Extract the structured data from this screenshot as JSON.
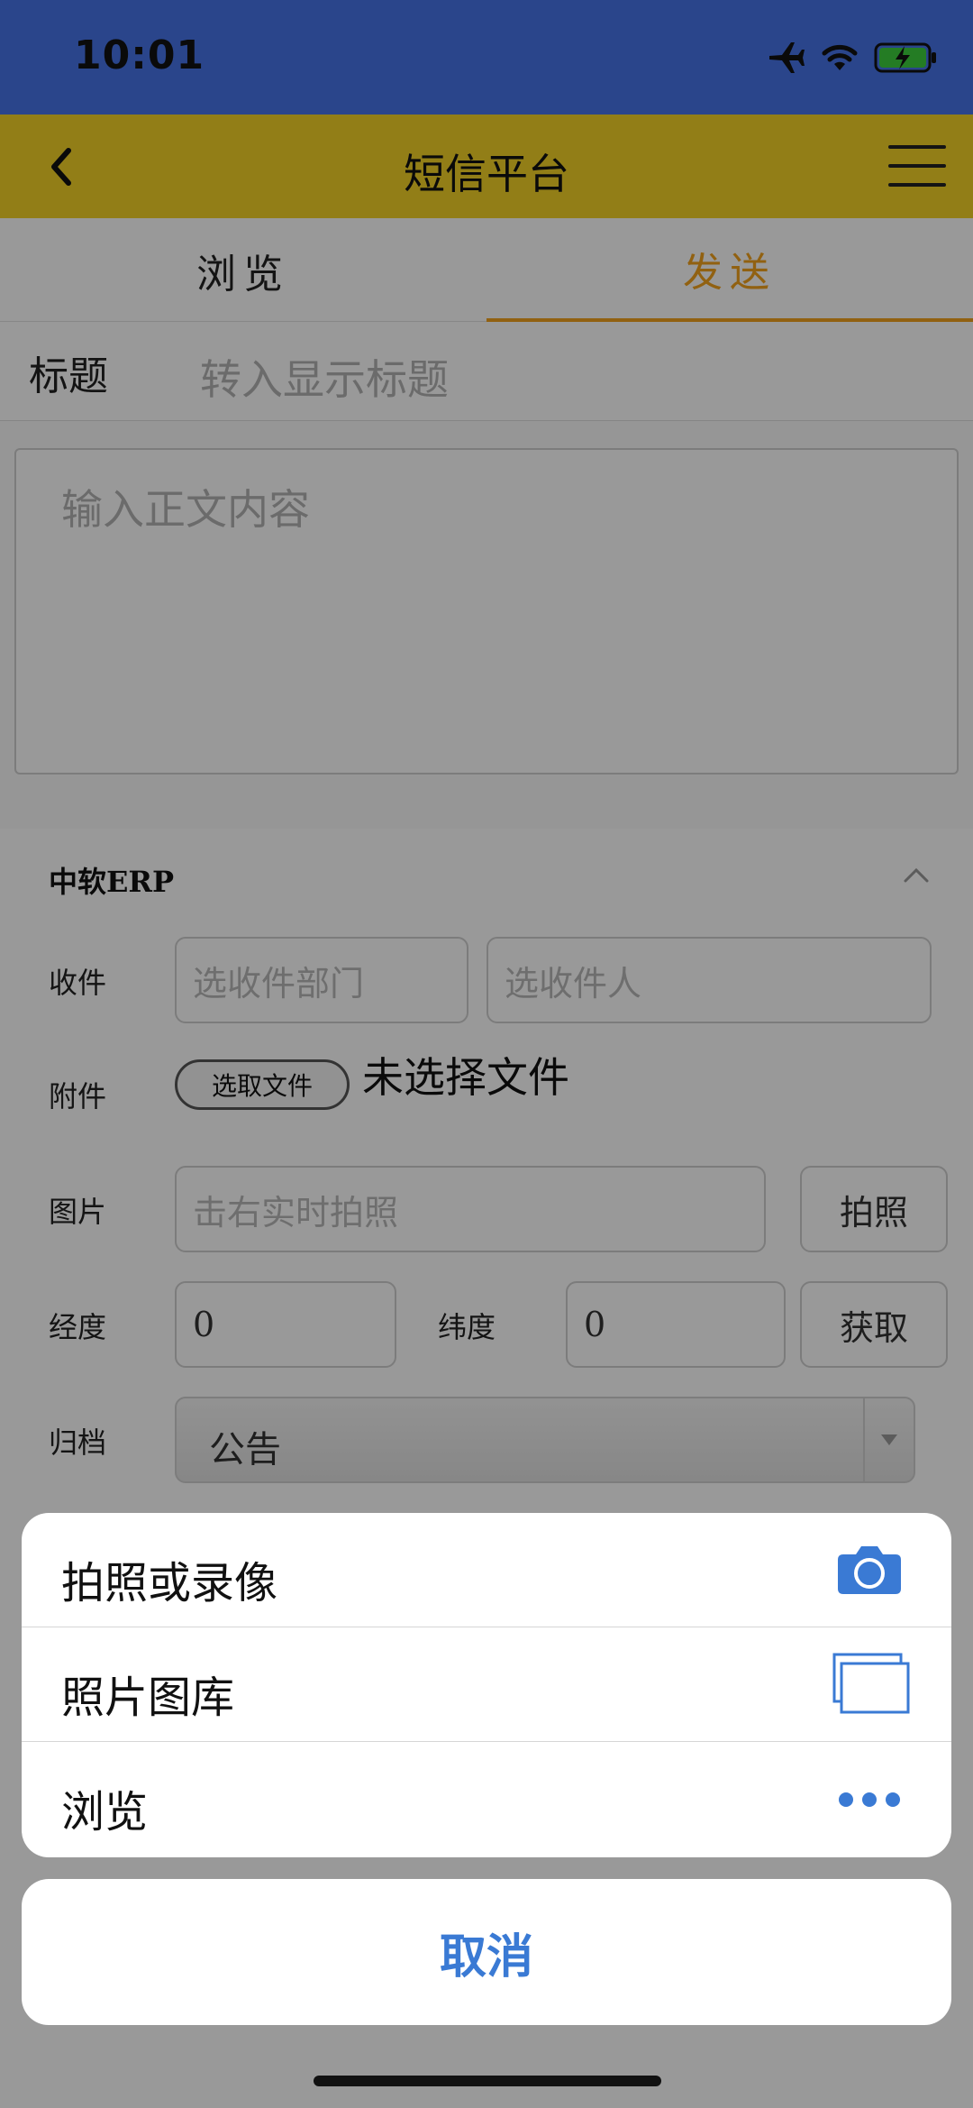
{
  "status_bar": {
    "time": "10:01",
    "icons": [
      "airplane-icon",
      "wifi-icon",
      "battery-charging-icon"
    ],
    "background": "#4674e8"
  },
  "nav": {
    "title": "短信平台",
    "background": "#f4d227"
  },
  "tabs": [
    {
      "label": "浏览",
      "active": false
    },
    {
      "label": "发送",
      "active": true
    }
  ],
  "accent_color": "#f2a21d",
  "message": {
    "title_label": "标题",
    "title_placeholder": "转入显示标题",
    "body_placeholder": "输入正文内容"
  },
  "form": {
    "header": "中软ERP",
    "recipient_label": "收件",
    "department_placeholder": "选收件部门",
    "person_placeholder": "选收件人",
    "attachment_label": "附件",
    "file_button": "选取文件",
    "no_file_text": "未选择文件",
    "image_label": "图片",
    "image_placeholder": "击右实时拍照",
    "photo_button": "拍照",
    "longitude_label": "经度",
    "longitude_value": "0",
    "latitude_label": "纬度",
    "latitude_value": "0",
    "fetch_button": "获取",
    "archive_label": "归档",
    "archive_value": "公告"
  },
  "action_sheet": {
    "items": [
      {
        "label": "拍照或录像",
        "icon": "camera-icon"
      },
      {
        "label": "照片图库",
        "icon": "photo-library-icon"
      },
      {
        "label": "浏览",
        "icon": "more-dots-icon"
      }
    ],
    "cancel": "取消",
    "icon_color": "#3a7ad4"
  }
}
